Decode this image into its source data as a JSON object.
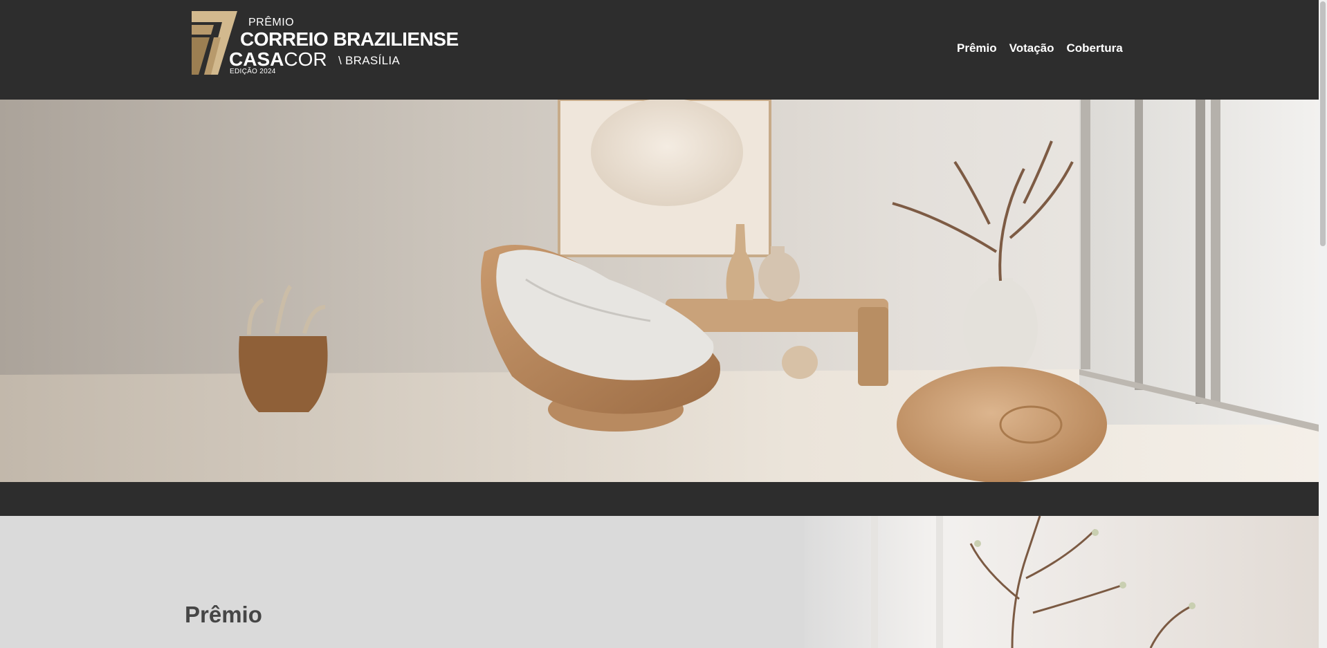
{
  "logo": {
    "line1": "PRÊMIO",
    "line2": "CORREIO BRAZILIENSE",
    "casa": "CASA",
    "cor": "COR",
    "city": "\\ BRASÍLIA",
    "edition": "EDIÇÃO 2024"
  },
  "nav": {
    "items": [
      "Prêmio",
      "Votação",
      "Cobertura"
    ]
  },
  "section": {
    "title": "Prêmio"
  },
  "colors": {
    "header_bg": "#2d2d2d",
    "section_bg": "#dadada",
    "title_text": "#464646",
    "logo_gold": "#b89a6c",
    "nav_text": "#ffffff"
  }
}
